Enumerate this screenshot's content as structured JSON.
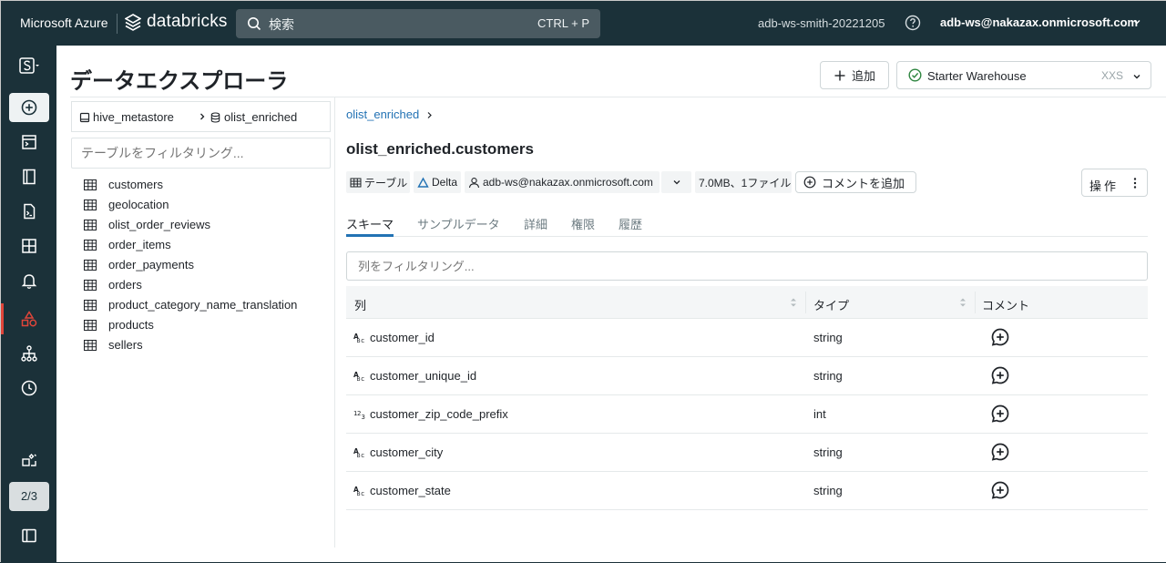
{
  "topbar": {
    "brand": "Microsoft Azure",
    "product": "databricks",
    "search_placeholder": "検索",
    "search_shortcut": "CTRL + P",
    "workspace": "adb-ws-smith-20221205",
    "account": "adb-ws@nakazax.onmicrosoft.com"
  },
  "leftnav": {
    "items": [
      "workspace-switcher",
      "new",
      "workspace",
      "recents",
      "sql-editor",
      "dashboards",
      "alerts",
      "data-explorer",
      "workflows",
      "query-history",
      "partner-connect"
    ],
    "active": "data-explorer",
    "pager": "2/3"
  },
  "page": {
    "title": "データエクスプローラ",
    "add_label": "追加",
    "warehouse": {
      "name": "Starter Warehouse",
      "size": "XXS",
      "status_color": "#2e8540"
    }
  },
  "left_panel": {
    "catalog": "hive_metastore",
    "schema": "olist_enriched",
    "filter_placeholder": "テーブルをフィルタリング...",
    "tables": [
      "customers",
      "geolocation",
      "olist_order_reviews",
      "order_items",
      "order_payments",
      "orders",
      "product_category_name_translation",
      "products",
      "sellers"
    ]
  },
  "detail": {
    "breadcrumb": "olist_enriched",
    "title": "olist_enriched.customers",
    "tags": {
      "type": "テーブル",
      "format": "Delta",
      "owner": "adb-ws@nakazax.onmicrosoft.com",
      "size": "7.0MB、1ファイル"
    },
    "add_comment": "コメントを追加",
    "operations": "操作",
    "tabs": [
      "スキーマ",
      "サンプルデータ",
      "詳細",
      "権限",
      "履歴"
    ],
    "active_tab": "スキーマ",
    "column_filter_placeholder": "列をフィルタリング...",
    "grid": {
      "headers": {
        "column": "列",
        "type": "タイプ",
        "comment": "コメント"
      },
      "rows": [
        {
          "name": "customer_id",
          "type": "string",
          "icon": "string-type-icon"
        },
        {
          "name": "customer_unique_id",
          "type": "string",
          "icon": "string-type-icon"
        },
        {
          "name": "customer_zip_code_prefix",
          "type": "int",
          "icon": "number-type-icon"
        },
        {
          "name": "customer_city",
          "type": "string",
          "icon": "string-type-icon"
        },
        {
          "name": "customer_state",
          "type": "string",
          "icon": "string-type-icon"
        }
      ]
    }
  },
  "colors": {
    "topbar": "#1b3139",
    "accent": "#2272b4",
    "active_nav": "#e0453a"
  }
}
